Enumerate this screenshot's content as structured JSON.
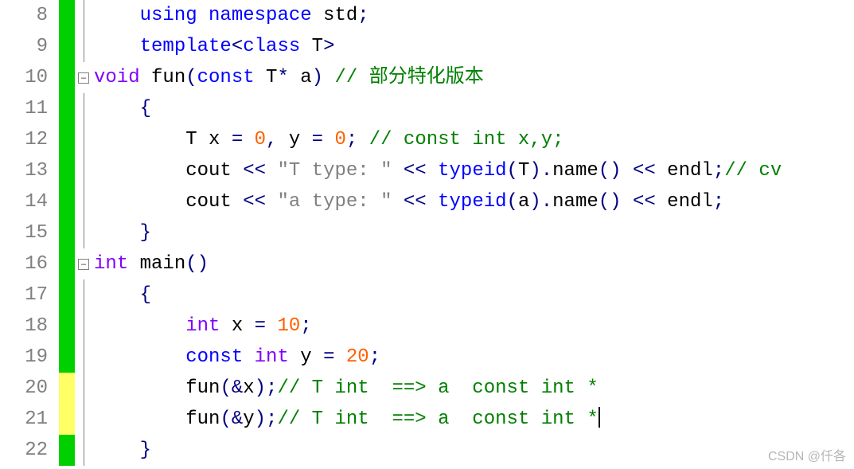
{
  "watermark": "CSDN @仟各",
  "lines": [
    {
      "num": "8",
      "marker": "green",
      "fold": "line",
      "indent": "    ",
      "tokens": [
        [
          "kw",
          "using"
        ],
        [
          "ident",
          " "
        ],
        [
          "kw",
          "namespace"
        ],
        [
          "ident",
          " std"
        ],
        [
          "op",
          ";"
        ]
      ]
    },
    {
      "num": "9",
      "marker": "green",
      "fold": "line",
      "indent": "    ",
      "tokens": [
        [
          "kw",
          "template"
        ],
        [
          "op",
          "<"
        ],
        [
          "kw",
          "class"
        ],
        [
          "ident",
          " T"
        ],
        [
          "op",
          ">"
        ]
      ]
    },
    {
      "num": "10",
      "marker": "green",
      "fold": "minus",
      "indent": "",
      "tokens": [
        [
          "type",
          "void"
        ],
        [
          "ident",
          " fun"
        ],
        [
          "op",
          "("
        ],
        [
          "kw",
          "const"
        ],
        [
          "ident",
          " T"
        ],
        [
          "op",
          "*"
        ],
        [
          "ident",
          " a"
        ],
        [
          "op",
          ") "
        ],
        [
          "comment",
          "// 部分特化版本"
        ]
      ]
    },
    {
      "num": "11",
      "marker": "green",
      "fold": "line",
      "indent": "    ",
      "tokens": [
        [
          "op",
          "{"
        ]
      ]
    },
    {
      "num": "12",
      "marker": "green",
      "fold": "line",
      "indent": "        ",
      "tokens": [
        [
          "ident",
          "T x "
        ],
        [
          "op",
          "="
        ],
        [
          "ident",
          " "
        ],
        [
          "num",
          "0"
        ],
        [
          "op",
          ","
        ],
        [
          "ident",
          " y "
        ],
        [
          "op",
          "="
        ],
        [
          "ident",
          " "
        ],
        [
          "num",
          "0"
        ],
        [
          "op",
          "; "
        ],
        [
          "comment",
          "// const int x,y;"
        ]
      ]
    },
    {
      "num": "13",
      "marker": "green",
      "fold": "line",
      "indent": "        ",
      "tokens": [
        [
          "ident",
          "cout "
        ],
        [
          "op",
          "<<"
        ],
        [
          "ident",
          " "
        ],
        [
          "str",
          "\"T type: \""
        ],
        [
          "ident",
          " "
        ],
        [
          "op",
          "<<"
        ],
        [
          "ident",
          " "
        ],
        [
          "kw",
          "typeid"
        ],
        [
          "op",
          "("
        ],
        [
          "ident",
          "T"
        ],
        [
          "op",
          ")."
        ],
        [
          "ident",
          "name"
        ],
        [
          "op",
          "() <<"
        ],
        [
          "ident",
          " endl"
        ],
        [
          "op",
          ";"
        ],
        [
          "comment",
          "// cv"
        ]
      ]
    },
    {
      "num": "14",
      "marker": "green",
      "fold": "line",
      "indent": "        ",
      "tokens": [
        [
          "ident",
          "cout "
        ],
        [
          "op",
          "<<"
        ],
        [
          "ident",
          " "
        ],
        [
          "str",
          "\"a type: \""
        ],
        [
          "ident",
          " "
        ],
        [
          "op",
          "<<"
        ],
        [
          "ident",
          " "
        ],
        [
          "kw",
          "typeid"
        ],
        [
          "op",
          "("
        ],
        [
          "ident",
          "a"
        ],
        [
          "op",
          ")."
        ],
        [
          "ident",
          "name"
        ],
        [
          "op",
          "() <<"
        ],
        [
          "ident",
          " endl"
        ],
        [
          "op",
          ";"
        ]
      ]
    },
    {
      "num": "15",
      "marker": "green",
      "fold": "line",
      "indent": "    ",
      "tokens": [
        [
          "op",
          "}"
        ]
      ]
    },
    {
      "num": "16",
      "marker": "green",
      "fold": "minus",
      "indent": "",
      "tokens": [
        [
          "type",
          "int"
        ],
        [
          "ident",
          " main"
        ],
        [
          "op",
          "()"
        ]
      ]
    },
    {
      "num": "17",
      "marker": "green",
      "fold": "line",
      "indent": "    ",
      "tokens": [
        [
          "op",
          "{"
        ]
      ]
    },
    {
      "num": "18",
      "marker": "green",
      "fold": "line",
      "indent": "        ",
      "tokens": [
        [
          "type",
          "int"
        ],
        [
          "ident",
          " x "
        ],
        [
          "op",
          "="
        ],
        [
          "ident",
          " "
        ],
        [
          "num",
          "10"
        ],
        [
          "op",
          ";"
        ]
      ]
    },
    {
      "num": "19",
      "marker": "green",
      "fold": "line",
      "indent": "        ",
      "tokens": [
        [
          "kw",
          "const"
        ],
        [
          "ident",
          " "
        ],
        [
          "type",
          "int"
        ],
        [
          "ident",
          " y "
        ],
        [
          "op",
          "="
        ],
        [
          "ident",
          " "
        ],
        [
          "num",
          "20"
        ],
        [
          "op",
          ";"
        ]
      ]
    },
    {
      "num": "20",
      "marker": "yellow",
      "fold": "line",
      "indent": "        ",
      "tokens": [
        [
          "ident",
          "fun"
        ],
        [
          "op",
          "(&"
        ],
        [
          "ident",
          "x"
        ],
        [
          "op",
          ");"
        ],
        [
          "comment",
          "// T int  ==> a  const int *"
        ]
      ]
    },
    {
      "num": "21",
      "marker": "yellow",
      "fold": "line",
      "indent": "        ",
      "tokens": [
        [
          "ident",
          "fun"
        ],
        [
          "op",
          "(&"
        ],
        [
          "ident",
          "y"
        ],
        [
          "op",
          ");"
        ],
        [
          "comment",
          "// T int  ==> a  const int *"
        ]
      ],
      "cursor": true
    },
    {
      "num": "22",
      "marker": "green",
      "fold": "line",
      "indent": "    ",
      "tokens": [
        [
          "op",
          "}"
        ]
      ]
    }
  ]
}
